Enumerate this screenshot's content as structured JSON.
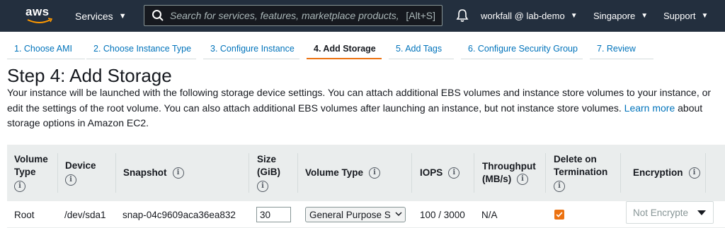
{
  "nav": {
    "logo_text": "aws",
    "services_label": "Services",
    "search_placeholder": "Search for services, features, marketplace products,",
    "search_shortcut": "[Alt+S]",
    "user_label": "workfall @ lab-demo",
    "region_label": "Singapore",
    "support_label": "Support"
  },
  "tabs": [
    {
      "label": "1. Choose AMI",
      "active": false
    },
    {
      "label": "2. Choose Instance Type",
      "active": false
    },
    {
      "label": "3. Configure Instance",
      "active": false
    },
    {
      "label": "4. Add Storage",
      "active": true
    },
    {
      "label": "5. Add Tags",
      "active": false
    },
    {
      "label": "6. Configure Security Group",
      "active": false
    },
    {
      "label": "7. Review",
      "active": false
    }
  ],
  "page": {
    "title": "Step 4: Add Storage",
    "description_1": "Your instance will be launched with the following storage device settings. You can attach additional EBS volumes and instance store volumes to your instance, or edit the settings of the root volume. You can also attach additional EBS volumes after launching an instance, but not instance store volumes.",
    "learn_more": "Learn more",
    "description_2": "about storage options in Amazon EC2."
  },
  "table": {
    "headers": {
      "volume_type_1": "Volume",
      "volume_type_2": "Type",
      "device": "Device",
      "snapshot": "Snapshot",
      "size_1": "Size",
      "size_2": "(GiB)",
      "volume_type_col": "Volume Type",
      "iops": "IOPS",
      "throughput_1": "Throughput",
      "throughput_2": "(MB/s)",
      "delete_1": "Delete on",
      "delete_2": "Termination",
      "encryption": "Encryption",
      "info": "i"
    },
    "row": {
      "volume_type": "Root",
      "device": "/dev/sda1",
      "snapshot": "snap-04c9609aca36ea832",
      "size": "30",
      "volume_type_value": "General Purpose S",
      "iops": "100 / 3000",
      "throughput": "N/A",
      "delete_on_termination": true,
      "encryption": "Not Encrypte"
    }
  },
  "colors": {
    "nav_bg": "#232f3e",
    "link": "#0073bb",
    "accent": "#ec7211",
    "header_bg": "#eaeded"
  },
  "icons": {
    "search": "search-icon",
    "bell": "bell-icon",
    "info": "info-icon",
    "caret": "chevron-down-icon",
    "check": "checkmark-icon"
  }
}
